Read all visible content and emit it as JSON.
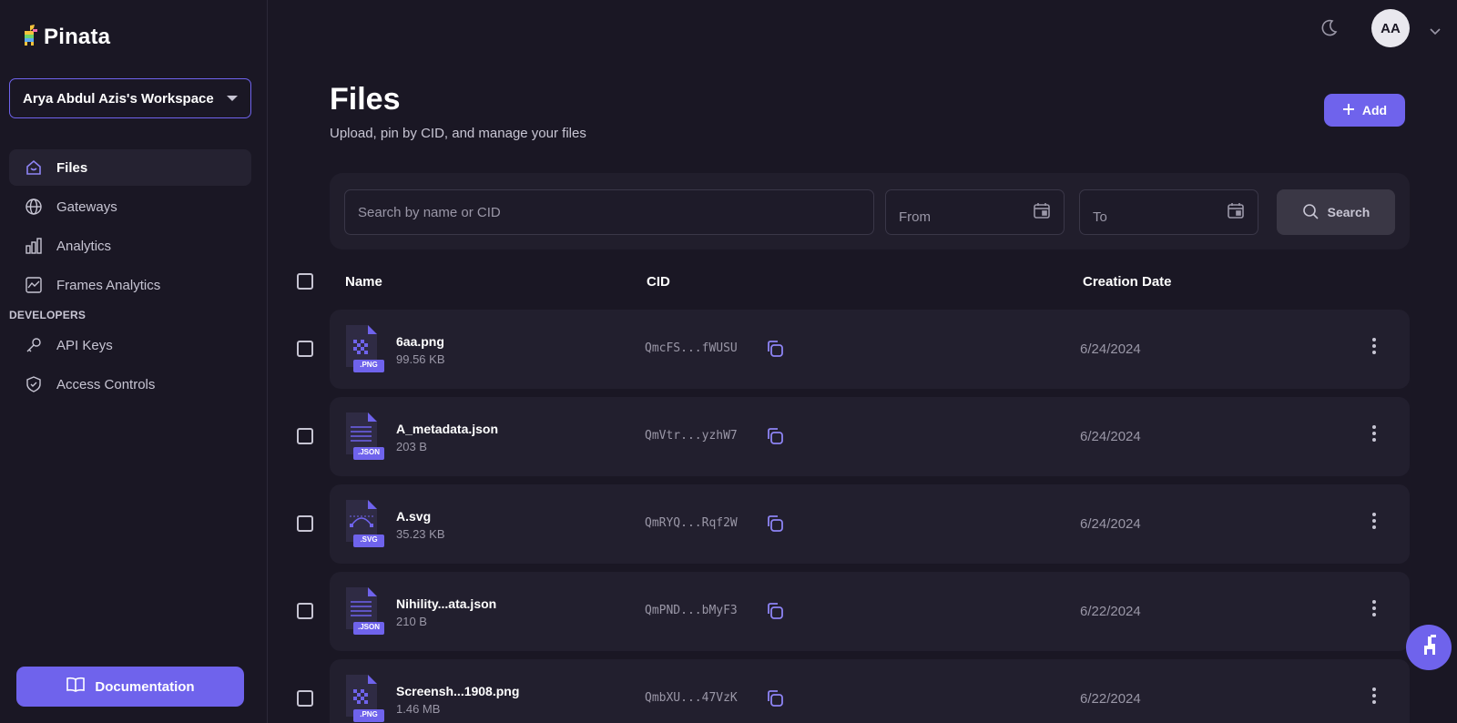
{
  "app": {
    "logo_text": "Pinata"
  },
  "sidebar": {
    "workspace": "Arya Abdul Azis's Workspace",
    "items": [
      {
        "label": "Files",
        "icon": "home-icon",
        "active": true
      },
      {
        "label": "Gateways",
        "icon": "globe-icon",
        "active": false
      },
      {
        "label": "Analytics",
        "icon": "bar-chart-icon",
        "active": false
      },
      {
        "label": "Frames Analytics",
        "icon": "line-chart-icon",
        "active": false
      }
    ],
    "developers_label": "DEVELOPERS",
    "dev_items": [
      {
        "label": "API Keys",
        "icon": "key-icon"
      },
      {
        "label": "Access Controls",
        "icon": "shield-icon"
      }
    ],
    "documentation_label": "Documentation"
  },
  "header": {
    "avatar_initials": "AA",
    "title": "Files",
    "subtitle": "Upload, pin by CID, and manage your files",
    "add_label": "Add"
  },
  "filters": {
    "search_placeholder": "Search by name or CID",
    "from_placeholder": "From",
    "to_placeholder": "To",
    "search_button": "Search"
  },
  "table": {
    "columns": {
      "name": "Name",
      "cid": "CID",
      "date": "Creation Date"
    },
    "rows": [
      {
        "name": "6aa.png",
        "size": "99.56 KB",
        "cid": "QmcFS...fWUSU",
        "date": "6/24/2024",
        "type": ".PNG"
      },
      {
        "name": "A_metadata.json",
        "size": "203 B",
        "cid": "QmVtr...yzhW7",
        "date": "6/24/2024",
        "type": ".JSON"
      },
      {
        "name": "A.svg",
        "size": "35.23 KB",
        "cid": "QmRYQ...Rqf2W",
        "date": "6/24/2024",
        "type": ".SVG"
      },
      {
        "name": "Nihility...ata.json",
        "size": "210 B",
        "cid": "QmPND...bMyF3",
        "date": "6/22/2024",
        "type": ".JSON"
      },
      {
        "name": "Screensh...1908.png",
        "size": "1.46 MB",
        "cid": "QmbXU...47VzK",
        "date": "6/22/2024",
        "type": ".PNG"
      }
    ]
  },
  "colors": {
    "accent": "#6f63ec",
    "background": "#1a1724",
    "card": "#221f2e"
  }
}
